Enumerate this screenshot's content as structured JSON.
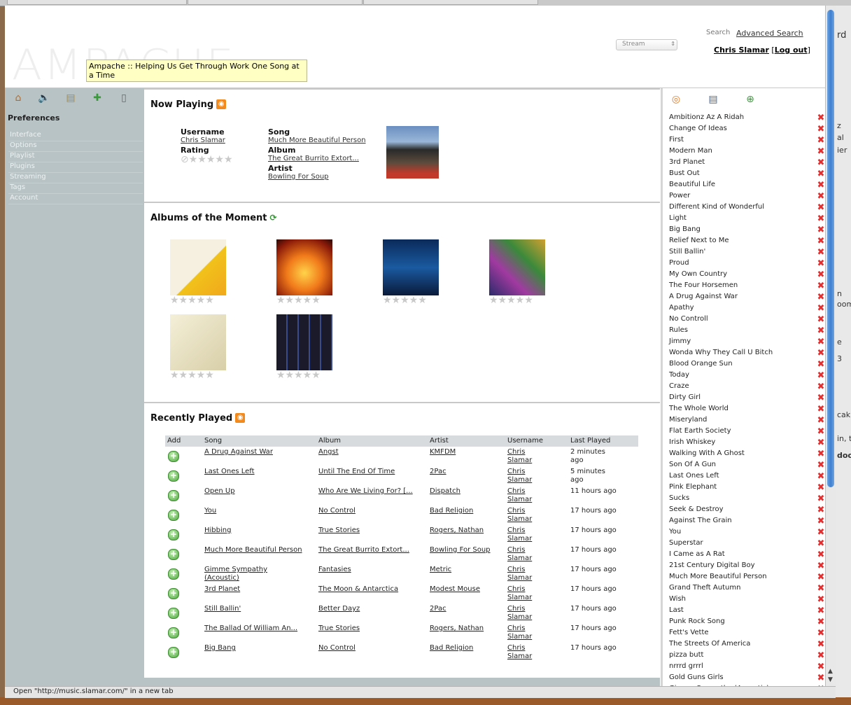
{
  "app": {
    "logo_text": "AMPACHE",
    "tooltip": "Ampache :: Helping Us Get Through Work One Song at a Time"
  },
  "header": {
    "stream_select_value": "Stream",
    "search_label": "Search",
    "advanced_search_label": "Advanced Search",
    "user_name": "Chris Slamar",
    "logout_label": "Log out"
  },
  "sidebar": {
    "icons": [
      "home-icon",
      "speaker-icon",
      "notepad-icon",
      "puzzle-icon",
      "page-icon"
    ],
    "heading": "Preferences",
    "items": [
      "Interface",
      "Options",
      "Playlist",
      "Plugins",
      "Streaming",
      "Tags",
      "Account"
    ]
  },
  "now_playing": {
    "title": "Now Playing",
    "username_label": "Username",
    "username": "Chris Slamar",
    "rating_label": "Rating",
    "song_label": "Song",
    "song": "Much More Beautiful Person",
    "album_label": "Album",
    "album": "The Great Burrito Extort...",
    "artist_label": "Artist",
    "artist": "Bowling For Soup",
    "rating_stars": 0
  },
  "albums_of_moment": {
    "title": "Albums of the Moment",
    "albums": [
      {
        "cover": "highway-to-hell-cover",
        "rating": 0
      },
      {
        "cover": "flames-cover",
        "rating": 0
      },
      {
        "cover": "children-of-bodom-cover",
        "rating": 0
      },
      {
        "cover": "dispatch-who-are-we-living-for-cover",
        "rating": 0
      },
      {
        "cover": "blank-cover",
        "rating": 0
      },
      {
        "cover": "beatles-hard-days-night-cover",
        "rating": 0
      }
    ]
  },
  "recently_played": {
    "title": "Recently Played",
    "headers": [
      "Add",
      "Song",
      "Album",
      "Artist",
      "Username",
      "Last Played"
    ],
    "rows": [
      {
        "song": "A Drug Against War",
        "album": "Angst",
        "artist": "KMFDM",
        "username": "Chris Slamar",
        "last_played": "2 minutes ago"
      },
      {
        "song": "Last Ones Left",
        "album": "Until The End Of Time",
        "artist": "2Pac",
        "username": "Chris Slamar",
        "last_played": "5 minutes ago"
      },
      {
        "song": "Open Up",
        "album": "Who Are We Living For? [...",
        "artist": "Dispatch",
        "username": "Chris Slamar",
        "last_played": "11 hours ago"
      },
      {
        "song": "You",
        "album": "No Control",
        "artist": "Bad Religion",
        "username": "Chris Slamar",
        "last_played": "17 hours ago"
      },
      {
        "song": "Hibbing",
        "album": "True Stories",
        "artist": "Rogers, Nathan",
        "username": "Chris Slamar",
        "last_played": "17 hours ago"
      },
      {
        "song": "Much More Beautiful Person",
        "album": "The Great Burrito Extort...",
        "artist": "Bowling For Soup",
        "username": "Chris Slamar",
        "last_played": "17 hours ago"
      },
      {
        "song": "Gimme Sympathy (Acoustic)",
        "album": "Fantasies",
        "artist": "Metric",
        "username": "Chris Slamar",
        "last_played": "17 hours ago"
      },
      {
        "song": "3rd Planet",
        "album": "The Moon & Antarctica",
        "artist": "Modest Mouse",
        "username": "Chris Slamar",
        "last_played": "17 hours ago"
      },
      {
        "song": "Still Ballin'",
        "album": "Better Dayz",
        "artist": "2Pac",
        "username": "Chris Slamar",
        "last_played": "17 hours ago"
      },
      {
        "song": "The Ballad Of William An...",
        "album": "True Stories",
        "artist": "Rogers, Nathan",
        "username": "Chris Slamar",
        "last_played": "17 hours ago"
      },
      {
        "song": "Big Bang",
        "album": "No Control",
        "artist": "Bad Religion",
        "username": "Chris Slamar",
        "last_played": "17 hours ago"
      }
    ]
  },
  "playlist": {
    "icons": [
      "podcast-icon",
      "save-playlist-icon",
      "add-icon"
    ],
    "items": [
      "Ambitionz Az A Ridah",
      "Change Of Ideas",
      "First",
      "Modern Man",
      "3rd Planet",
      "Bust Out",
      "Beautiful Life",
      "Power",
      "Different Kind of Wonderful",
      "Light",
      "Big Bang",
      "Relief Next to Me",
      "Still Ballin'",
      "Proud",
      "My Own Country",
      "The Four Horsemen",
      "A Drug Against War",
      "Apathy",
      "No Controll",
      "Rules",
      "Jimmy",
      "Wonda Why They Call U Bitch",
      "Blood Orange Sun",
      "Today",
      "Craze",
      "Dirty Girl",
      "The Whole World",
      "Miseryland",
      "Flat Earth Society",
      "Irish Whiskey",
      "Walking With A Ghost",
      "Son Of A Gun",
      "Last Ones Left",
      "Pink Elephant",
      "Sucks",
      "Seek & Destroy",
      "Against The Grain",
      "You",
      "Superstar",
      "I Came as A Rat",
      "21st Century Digital Boy",
      "Much More Beautiful Person",
      "Grand Theft Autumn",
      "Wish",
      "Last",
      "Punk Rock Song",
      "Fett's Vette",
      "The Streets Of America",
      "pizza butt",
      "nrrrd grrrl",
      "Gold Guns Girls",
      "Gimme Sympathy (Acoustic)"
    ]
  },
  "status_bar": {
    "text": "Open \"http://music.slamar.com/\" in a new tab"
  },
  "desktop_fragments": [
    "rd",
    "z",
    "al",
    "ier",
    "n",
    "oom",
    "e",
    "3",
    "cak",
    "in, t",
    "doo"
  ],
  "colors": {
    "sidebar_bg": "#b8c3c5",
    "tooltip_bg": "#ffffc4",
    "rss_orange": "#f28a1e",
    "delete_red": "#e23030",
    "add_green": "#4aa83a"
  }
}
